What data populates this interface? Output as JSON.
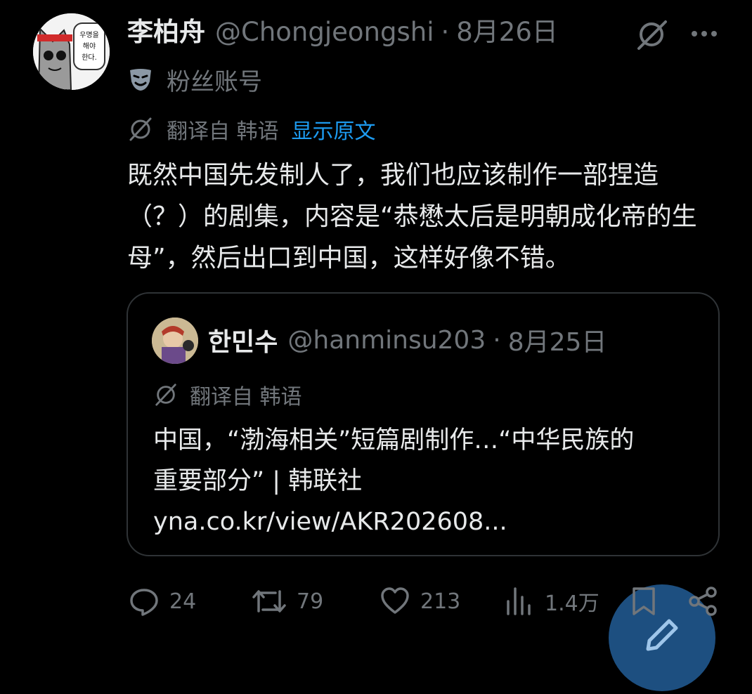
{
  "tweet": {
    "author_name": "李柏舟",
    "handle": "@Chongjeongshi",
    "separator": "·",
    "date": "8月26日",
    "badge_label": "粉丝账号",
    "translated_from": "翻译自 韩语",
    "show_original": "显示原文",
    "text": "既然中国先发制人了，我们也应该制作一部捏造（？）的剧集，内容是“恭懋太后是明朝成化帝的生母”，然后出口到中国，这样好像不错。"
  },
  "quote": {
    "author_name": "한민수",
    "handle": "@hanminsu203",
    "separator": "·",
    "date": "8月25日",
    "translated_from": "翻译自 韩语",
    "text_line1": "中国，“渤海相关”短篇剧制作…“中华民族的",
    "text_line2": "重要部分” | 韩联社",
    "link": "yna.co.kr/view/AKR202608..."
  },
  "actions": {
    "replies": "24",
    "reposts": "79",
    "likes": "213",
    "views": "1.4万"
  },
  "avatar_text": [
    "우명을",
    "해야",
    "한다."
  ],
  "colors": {
    "background": "#000000",
    "text": "#e7e9ea",
    "muted": "#71767b",
    "accent": "#1d9bf0",
    "border": "#2f3336"
  },
  "icons": [
    "grok-icon",
    "more-icon",
    "fan-account-mask-icon",
    "translate-icon",
    "reply-icon",
    "repost-icon",
    "like-icon",
    "views-icon",
    "bookmark-icon",
    "share-icon",
    "compose-icon"
  ]
}
